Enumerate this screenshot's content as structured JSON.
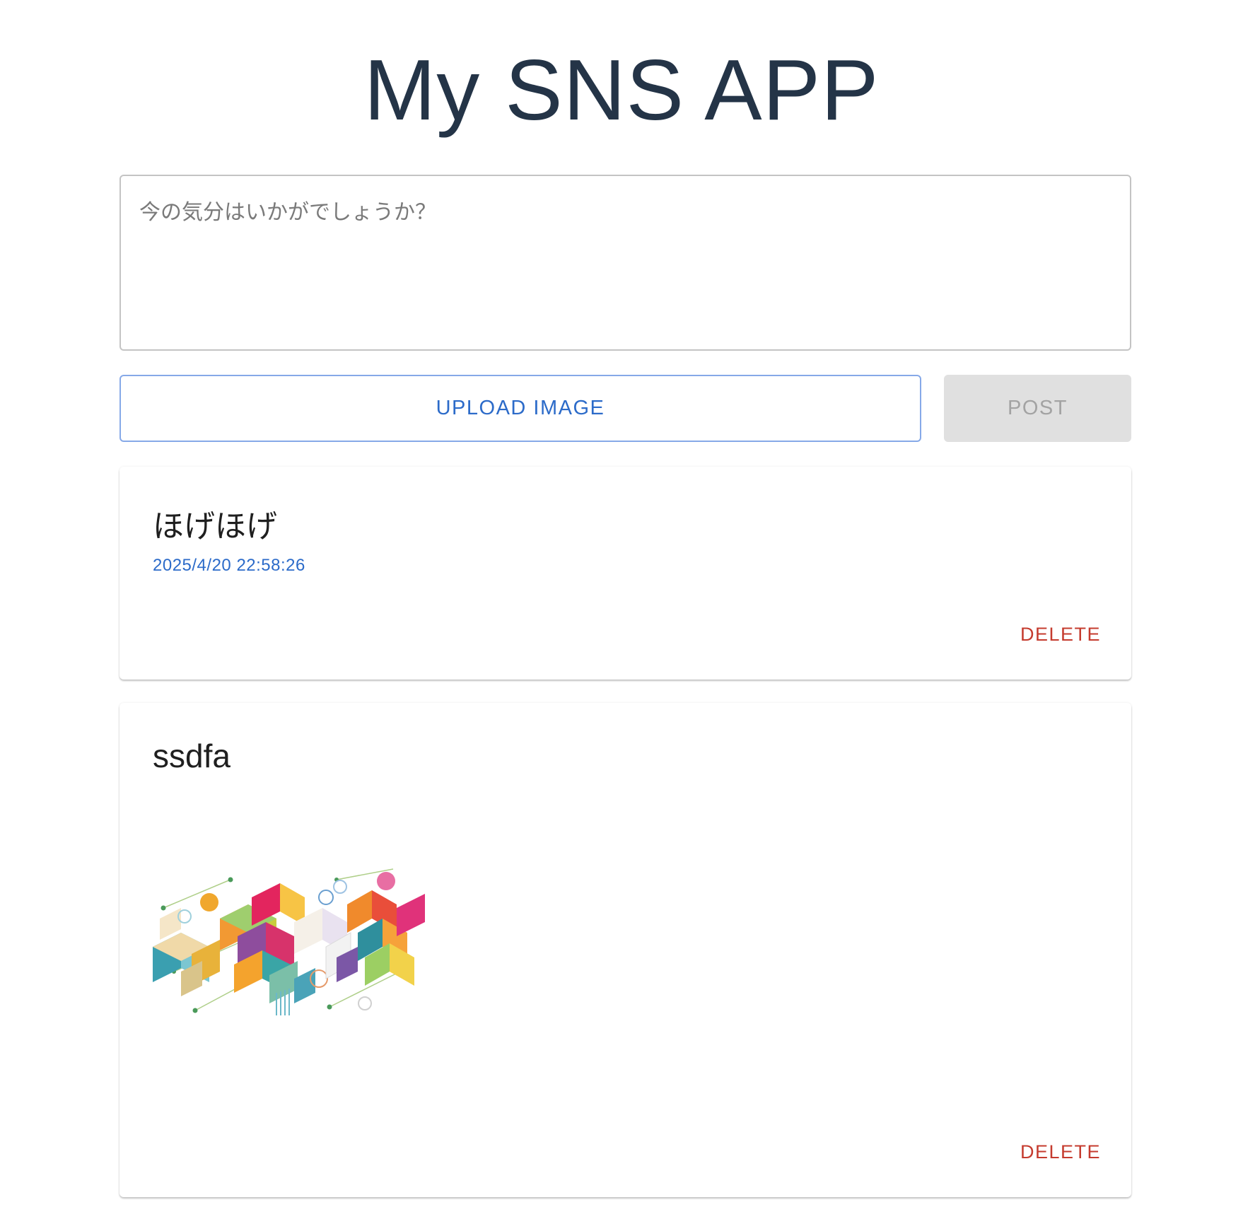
{
  "app": {
    "title": "My SNS APP"
  },
  "composer": {
    "placeholder": "今の気分はいかがでしょうか？",
    "value": ""
  },
  "actions": {
    "upload_label": "UPLOAD IMAGE",
    "post_label": "POST",
    "post_enabled": false
  },
  "posts": [
    {
      "text": "ほげほげ",
      "date": "2025/4/20 22:58:26",
      "has_image": false,
      "delete_label": "DELETE"
    },
    {
      "text": "ssdfa",
      "date": "",
      "has_image": true,
      "image_icon": "geometric-abstract-image",
      "delete_label": "DELETE"
    }
  ],
  "colors": {
    "title": "#243447",
    "accent": "#2c6bc9",
    "danger": "#c53b2e",
    "disabled_bg": "#e0e0e0",
    "disabled_text": "#a3a3a3"
  }
}
